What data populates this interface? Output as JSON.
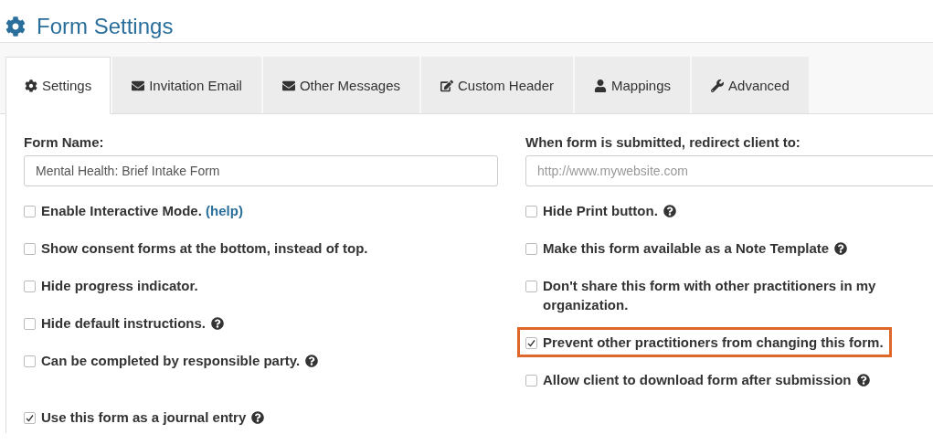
{
  "page_title": "Form Settings",
  "tabs": [
    {
      "label": "Settings",
      "selected": true
    },
    {
      "label": "Invitation Email",
      "selected": false
    },
    {
      "label": "Other Messages",
      "selected": false
    },
    {
      "label": "Custom Header",
      "selected": false
    },
    {
      "label": "Mappings",
      "selected": false
    },
    {
      "label": "Advanced",
      "selected": false
    }
  ],
  "left": {
    "label": "Form Name:",
    "value": "Mental Health: Brief Intake Form",
    "options": [
      {
        "label": "Enable Interactive Mode.",
        "link": "(help)",
        "checked": false,
        "help_icon": false,
        "highlighted": false
      },
      {
        "label": "Show consent forms at the bottom, instead of top.",
        "checked": false,
        "help_icon": false,
        "highlighted": false
      },
      {
        "label": "Hide progress indicator.",
        "checked": false,
        "help_icon": false,
        "highlighted": false
      },
      {
        "label": "Hide default instructions.",
        "checked": false,
        "help_icon": true,
        "highlighted": false
      },
      {
        "label": "Can be completed by responsible party.",
        "checked": false,
        "help_icon": true,
        "highlighted": false
      },
      {
        "label": "Use this form as a journal entry",
        "checked": true,
        "help_icon": true,
        "highlighted": false
      }
    ]
  },
  "right": {
    "label": "When form is submitted, redirect client to:",
    "placeholder": "http://www.mywebsite.com",
    "options": [
      {
        "label": "Hide Print button.",
        "checked": false,
        "help_icon": true,
        "highlighted": false
      },
      {
        "label": "Make this form available as a Note Template",
        "checked": false,
        "help_icon": true,
        "highlighted": false
      },
      {
        "label": "Don't share this form with other practitioners in my organization.",
        "checked": false,
        "help_icon": false,
        "highlighted": false
      },
      {
        "label": "Prevent other practitioners from changing this form.",
        "checked": true,
        "help_icon": false,
        "highlighted": true
      },
      {
        "label": "Allow client to download form after submission",
        "checked": false,
        "help_icon": true,
        "highlighted": false
      }
    ]
  }
}
